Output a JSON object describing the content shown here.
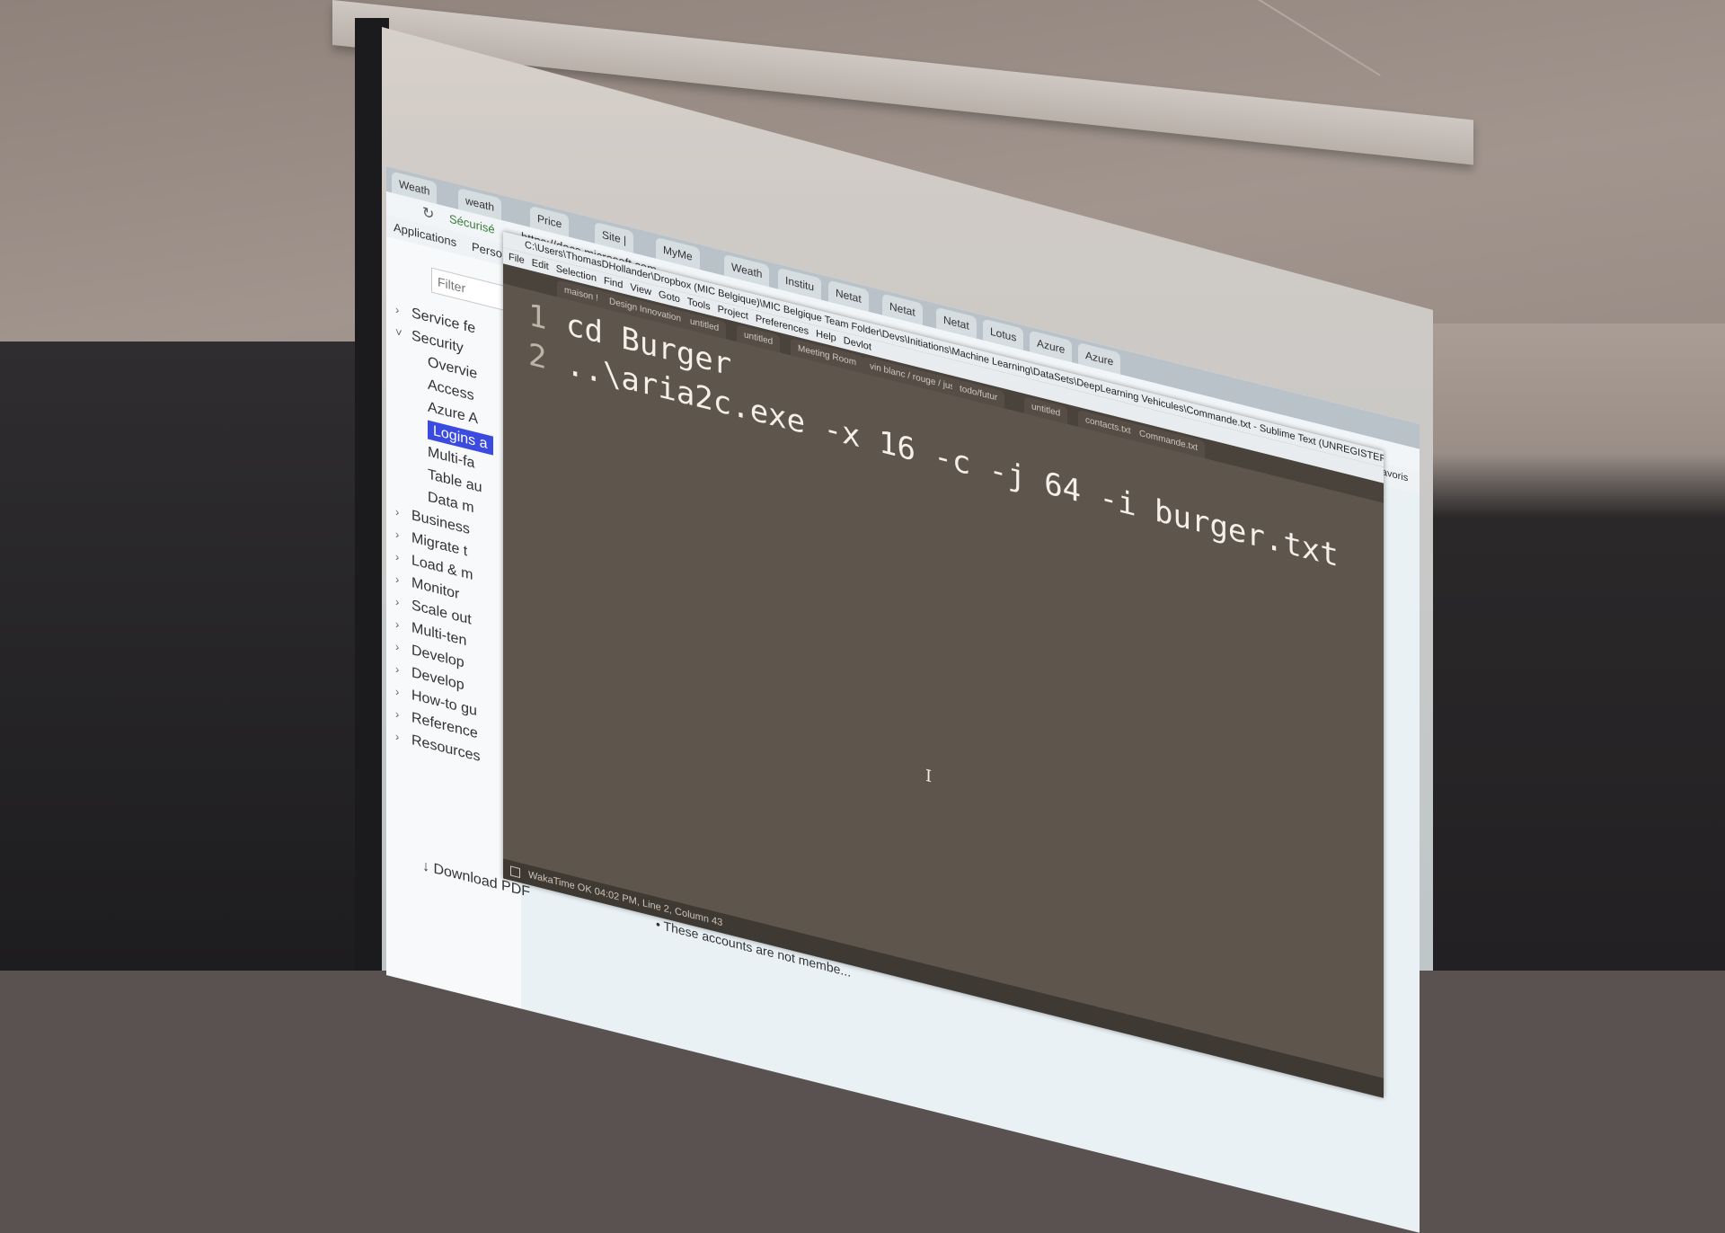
{
  "browser": {
    "tabs": [
      "Weath",
      "weath",
      "Price",
      "Site |",
      "MyMe",
      "Weath",
      "Institu",
      "Netat",
      "Netat",
      "Netat",
      "Lotus",
      "Azure",
      "Azure"
    ],
    "secure_label": "Sécurisé",
    "url": "https://docs.microsoft.com",
    "bookmarks": [
      "Applications",
      "Perso"
    ],
    "other_bookmarks": "Autres favoris"
  },
  "docs": {
    "filter_placeholder": "Filter",
    "nav_items": [
      {
        "label": "Service fe",
        "chevron": "›"
      },
      {
        "label": "Security",
        "chevron": "˅"
      },
      {
        "label": "Overvie",
        "chevron": ""
      },
      {
        "label": "Access",
        "chevron": ""
      },
      {
        "label": "Azure A",
        "chevron": ""
      },
      {
        "label": "Logins a",
        "chevron": "",
        "active": true
      },
      {
        "label": "Multi-fa",
        "chevron": ""
      },
      {
        "label": "Table au",
        "chevron": ""
      },
      {
        "label": "Data m",
        "chevron": ""
      },
      {
        "label": "Business",
        "chevron": "›"
      },
      {
        "label": "Migrate t",
        "chevron": "›"
      },
      {
        "label": "Load & m",
        "chevron": "›"
      },
      {
        "label": "Monitor",
        "chevron": "›"
      },
      {
        "label": "Scale out",
        "chevron": "›"
      },
      {
        "label": "Multi-ten",
        "chevron": "›"
      },
      {
        "label": "Develop",
        "chevron": "›"
      },
      {
        "label": "Develop",
        "chevron": "›"
      },
      {
        "label": "How-to gu",
        "chevron": "›"
      },
      {
        "label": "Reference",
        "chevron": "›"
      },
      {
        "label": "Resources",
        "chevron": "›"
      }
    ],
    "download_pdf": "Download PDF",
    "bottom_note": "• These accounts are not membe..."
  },
  "sublime": {
    "title": "C:\\Users\\ThomasDHollander\\Dropbox (MIC Belgique)\\MIC Belgique Team Folder\\Devs\\Initiations\\Machine Learning\\DataSets\\DeepLearning Vehicules\\Commande.txt - Sublime Text (UNREGISTERED)",
    "menu": [
      "File",
      "Edit",
      "Selection",
      "Find",
      "View",
      "Goto",
      "Tools",
      "Project",
      "Preferences",
      "Help",
      "Devlot"
    ],
    "tabs": [
      "maison !",
      "Design Innovation",
      "untitled",
      "untitled",
      "Meeting Room",
      "vin blanc / rouge / jus fruit",
      "todo/futur",
      "untitled",
      "contacts.txt",
      "Commande.txt"
    ],
    "lines": [
      {
        "num": "1",
        "code": "cd Burger"
      },
      {
        "num": "2",
        "code": "..\\aria2c.exe -x 16 -c -j 64 -i burger.txt"
      }
    ],
    "status": "WakaTime OK 04:02 PM, Line 2, Column 43",
    "cursor_glyph": "I"
  }
}
